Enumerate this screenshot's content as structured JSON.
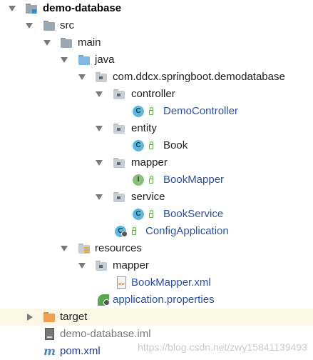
{
  "tree": {
    "project": "demo-database",
    "src": "src",
    "main": "main",
    "java": "java",
    "package": "com.ddcx.springboot.demodatabase",
    "controller": "controller",
    "demo_controller": "DemoController",
    "entity": "entity",
    "book": "Book",
    "mapper": "mapper",
    "book_mapper": "BookMapper",
    "service": "service",
    "book_service": "BookService",
    "config_application": "ConfigApplication",
    "resources": "resources",
    "res_mapper": "mapper",
    "book_mapper_xml": "BookMapper.xml",
    "application_properties": "application.properties",
    "target": "target",
    "iml": "demo-database.iml",
    "pom": "pom.xml",
    "class_badge": "C",
    "interface_badge": "I"
  },
  "colors": {
    "class_icon": "#5fb8d9",
    "interface_icon": "#8cc07a",
    "code_text": "#2a52a8",
    "target_folder": "#f0a050",
    "target_row_bg": "#fbf6e6"
  },
  "icons": [
    "project-folder-icon",
    "folder-icon",
    "source-folder-icon",
    "package-icon",
    "class-icon",
    "interface-icon",
    "lock-icon",
    "spring-boot-icon",
    "resources-folder-icon",
    "xml-file-icon",
    "properties-leaf-icon",
    "excluded-folder-icon",
    "iml-file-icon",
    "maven-icon"
  ],
  "watermark": "https://blog.csdn.net/zwy15841139493"
}
